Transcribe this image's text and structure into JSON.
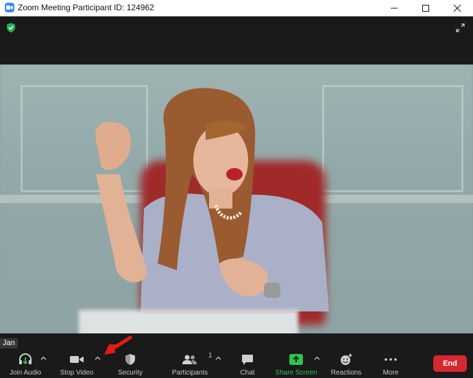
{
  "window": {
    "title": "Zoom Meeting Participant ID: 124962"
  },
  "participant": {
    "name": "Jan"
  },
  "toolbar": {
    "join_audio": "Join Audio",
    "stop_video": "Stop Video",
    "security": "Security",
    "participants": "Participants",
    "participants_count": "1",
    "chat": "Chat",
    "share_screen": "Share Screen",
    "reactions": "Reactions",
    "more": "More",
    "end": "End"
  },
  "colors": {
    "share_screen": "#2ec44a",
    "end": "#d7282f",
    "arrow": "#e31b1b"
  }
}
